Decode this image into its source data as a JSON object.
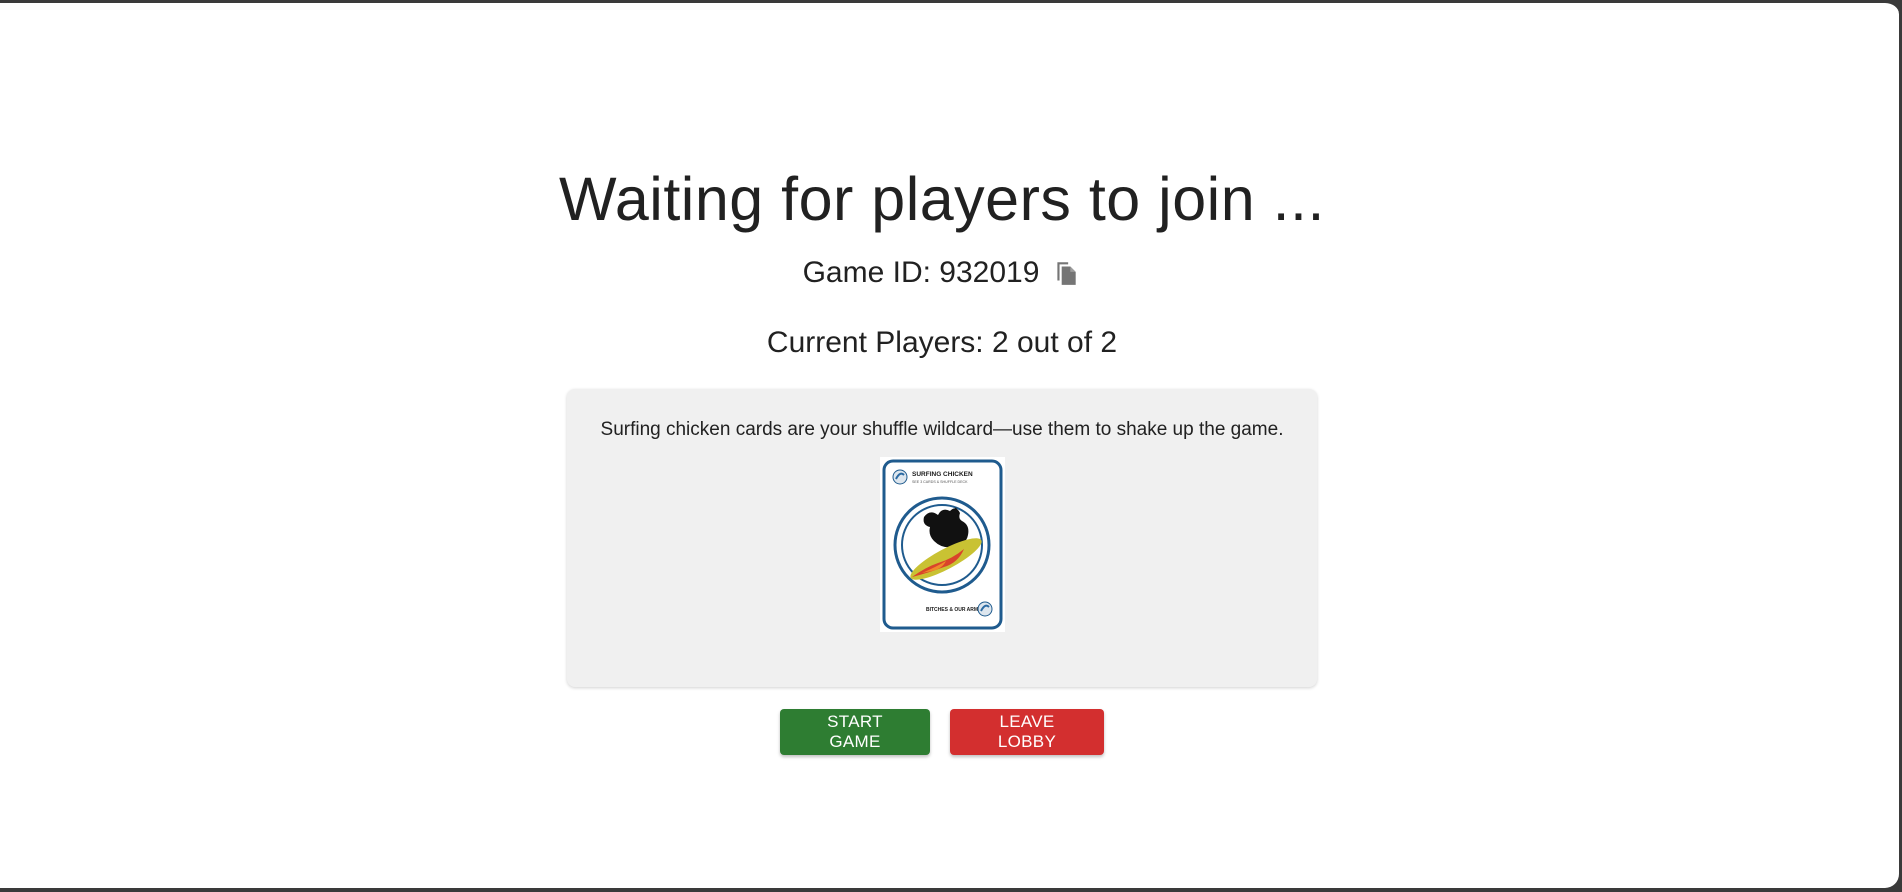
{
  "lobby": {
    "title": "Waiting for players to join ...",
    "game_id_label": "Game ID: 932019",
    "players_label": "Current Players: 2 out of 2",
    "tip": {
      "text": "Surfing chicken cards are your shuffle wildcard—use them to shake up the game.",
      "card": {
        "title": "SURFING CHICKEN",
        "subtitle": "SEE 3 CARDS & SHUFFLE DECK",
        "footer": "BITCHES & OUR ARMS"
      }
    },
    "actions": {
      "start_label": "START GAME",
      "leave_label": "LEAVE LOBBY"
    }
  },
  "colors": {
    "start": "#2e7d32",
    "leave": "#d32f2f",
    "card_border": "#1f5b8e",
    "tip_bg": "#f0f0f0"
  },
  "icons": {
    "copy": "copy-icon"
  }
}
